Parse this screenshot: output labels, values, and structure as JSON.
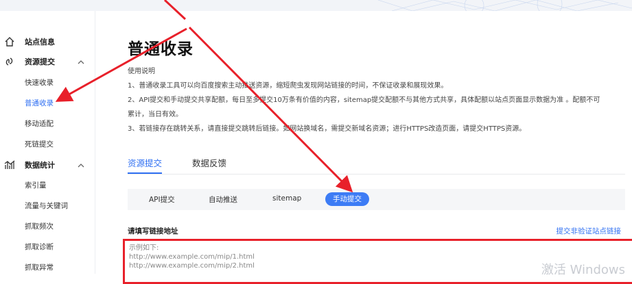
{
  "sidebar": {
    "groups": [
      {
        "label": "站点信息",
        "icon": "home-icon"
      },
      {
        "label": "资源提交",
        "icon": "link-icon"
      },
      {
        "label": "数据统计",
        "icon": "bar-chart-icon"
      }
    ],
    "resource_items": [
      "快速收录",
      "普通收录",
      "移动适配",
      "死链提交"
    ],
    "stats_items": [
      "索引量",
      "流量与关键词",
      "抓取频次",
      "抓取诊断",
      "抓取异常"
    ],
    "active_item": "普通收录"
  },
  "main": {
    "title": "普通收录",
    "intro_heading": "使用说明",
    "intro_lines": [
      "1、普通收录工具可以向百度搜索主动推送资源，缩短爬虫发现网站链接的时间，不保证收录和展现效果。",
      "2、API提交和手动提交共享配额，每日至多提交10万条有价值的内容，sitemap提交配额不与其他方式共享，具体配额以站点页面显示数据为准 。配额不可",
      "累计，当日有效。",
      "3、若链接存在跳转关系，请直接提交跳转后链接。如网站换域名，需提交新域名资源；进行HTTPS改造页面，请提交HTTPS资源。"
    ],
    "tabs": [
      "资源提交",
      "数据反馈"
    ],
    "subtabs": [
      "API提交",
      "自动推送",
      "sitemap",
      "手动提交"
    ],
    "field_label": "请填写链接地址",
    "field_link": "提交非验证站点链接",
    "textarea_placeholder": "示例如下:\nhttp://www.example.com/mip/1.html\nhttp://www.example.com/mip/2.html",
    "watermark": "激活 Windows"
  },
  "colors": {
    "accent": "#2f6ff2",
    "annotation": "#e8202a"
  }
}
